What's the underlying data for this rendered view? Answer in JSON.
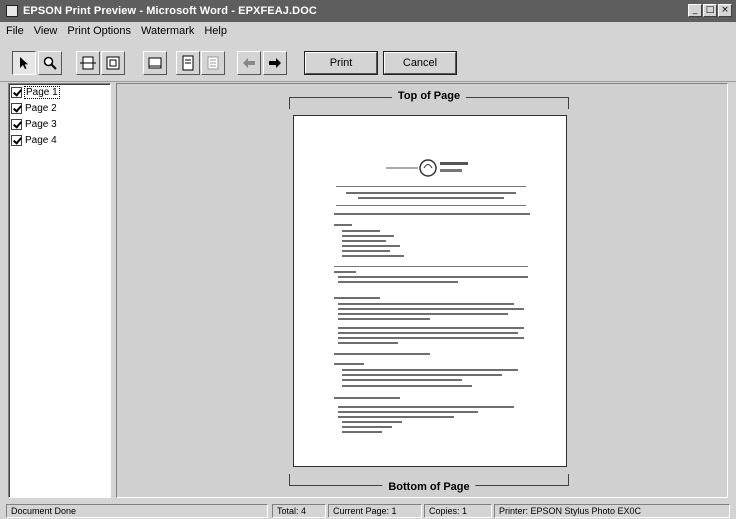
{
  "window": {
    "title": "EPSON Print Preview - Microsoft Word - EPXFEAJ.DOC",
    "minimize_glyph": "_",
    "maximize_glyph": "□",
    "close_glyph": "×"
  },
  "menu": {
    "items": [
      "File",
      "View",
      "Print Options",
      "Watermark",
      "Help"
    ]
  },
  "toolbar": {
    "icons": [
      "select-arrow-icon",
      "zoom-icon",
      "fit-width-icon",
      "fit-page-icon",
      "full-page-icon",
      "page-setup-icon",
      "settings-icon",
      "previous-page-icon",
      "next-page-icon"
    ],
    "print_label": "Print",
    "cancel_label": "Cancel"
  },
  "sidebar": {
    "pages": [
      {
        "label": "Page 1",
        "checked": true,
        "selected": true
      },
      {
        "label": "Page 2",
        "checked": true,
        "selected": false
      },
      {
        "label": "Page 3",
        "checked": true,
        "selected": false
      },
      {
        "label": "Page 4",
        "checked": true,
        "selected": false
      }
    ]
  },
  "preview": {
    "top_label": "Top of Page",
    "bottom_label": "Bottom of Page"
  },
  "status": {
    "message": "Document Done",
    "total": "Total: 4",
    "current_page": "Current Page: 1",
    "copies": "Copies: 1",
    "printer": "Printer: EPSON Stylus Photo EX0C"
  }
}
